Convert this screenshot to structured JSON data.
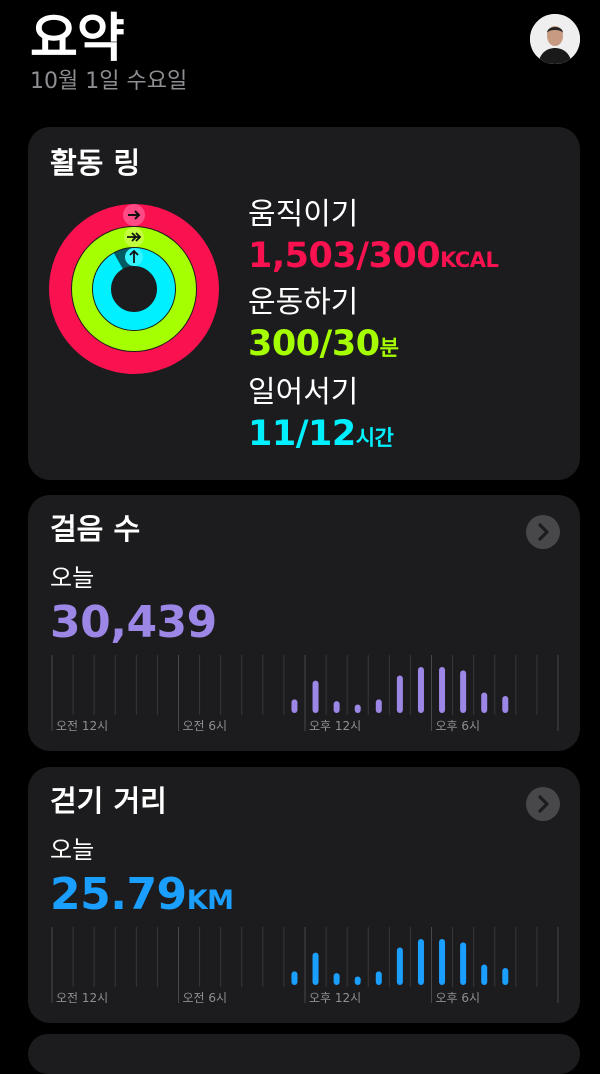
{
  "header": {
    "title": "요약",
    "date": "10월 1일 수요일"
  },
  "activity": {
    "title": "활동 링",
    "move": {
      "label": "움직이기",
      "value": "1,503/300",
      "unit": "KCAL",
      "color": "#fa114f",
      "progress": 5.01
    },
    "exercise": {
      "label": "운동하기",
      "value": "300/30",
      "unit": "분",
      "color": "#a6ff00",
      "progress": 10
    },
    "stand": {
      "label": "일어서기",
      "value": "11/12",
      "unit": "시간",
      "color": "#00f0ff",
      "progress": 0.917
    }
  },
  "steps": {
    "title": "걸음 수",
    "period": "오늘",
    "value": "30,439",
    "color": "#9d87e6",
    "axis_labels": [
      "오전 12시",
      "오전 6시",
      "오후 12시",
      "오후 6시"
    ],
    "hourly": [
      0,
      0,
      0,
      0,
      0,
      0,
      0,
      0,
      0,
      0,
      0,
      0.4,
      0.95,
      0.35,
      0.25,
      0.4,
      1.1,
      1.35,
      1.35,
      1.25,
      0.6,
      0.5,
      0,
      0
    ]
  },
  "distance": {
    "title": "걷기 거리",
    "period": "오늘",
    "value": "25.79",
    "unit": "KM",
    "color": "#1a9fff",
    "axis_labels": [
      "오전 12시",
      "오전 6시",
      "오후 12시",
      "오후 6시"
    ],
    "hourly": [
      0,
      0,
      0,
      0,
      0,
      0,
      0,
      0,
      0,
      0,
      0,
      0.4,
      0.95,
      0.35,
      0.25,
      0.4,
      1.1,
      1.35,
      1.35,
      1.25,
      0.6,
      0.5,
      0,
      0
    ]
  },
  "icons": {
    "move_arrow": "arrow-right-icon",
    "exercise_arrow": "double-arrow-right-icon",
    "stand_arrow": "arrow-up-icon",
    "chevron": "chevron-right-icon"
  }
}
